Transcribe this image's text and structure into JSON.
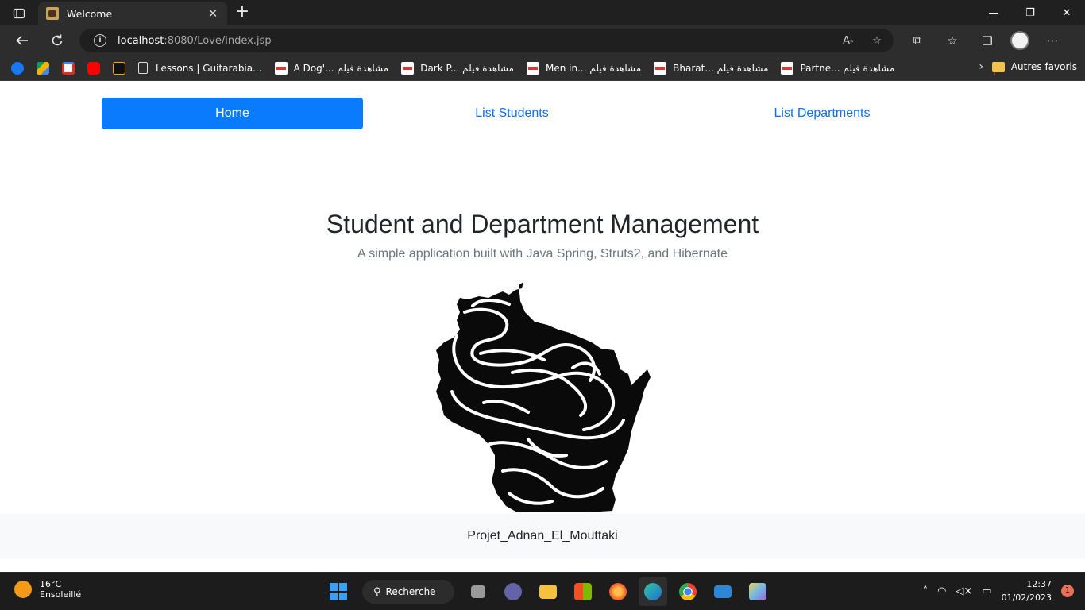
{
  "browser": {
    "tab_title": "Welcome",
    "url_host": "localhost",
    "url_rest": ":8080/Love/index.jsp",
    "bookmarks": [
      {
        "label": "Lessons | Guitarabia..."
      },
      {
        "label": "A Dog'... مشاهدة فيلم"
      },
      {
        "label": "Dark P... مشاهدة فيلم"
      },
      {
        "label": "Men in... مشاهدة فيلم"
      },
      {
        "label": "Bharat... مشاهدة فيلم"
      },
      {
        "label": "Partne... مشاهدة فيلم"
      }
    ],
    "other_bookmarks": "Autres favoris"
  },
  "nav": {
    "items": [
      {
        "label": "Home"
      },
      {
        "label": "List Students"
      },
      {
        "label": "List Departments"
      }
    ]
  },
  "hero": {
    "title": "Student and Department Management",
    "subtitle": "A simple application built with Java Spring, Struts2, and Hibernate"
  },
  "footer": {
    "text": "Projet_Adnan_El_Mouttaki"
  },
  "taskbar": {
    "temperature": "16°C",
    "condition": "Ensoleillé",
    "search_label": "Recherche",
    "time": "12:37",
    "date": "01/02/2023",
    "notification_count": "1"
  },
  "colors": {
    "primary": "#0b7bfd",
    "chrome_dark": "#2d2d2d",
    "footer_bg": "#f8f9fa"
  }
}
